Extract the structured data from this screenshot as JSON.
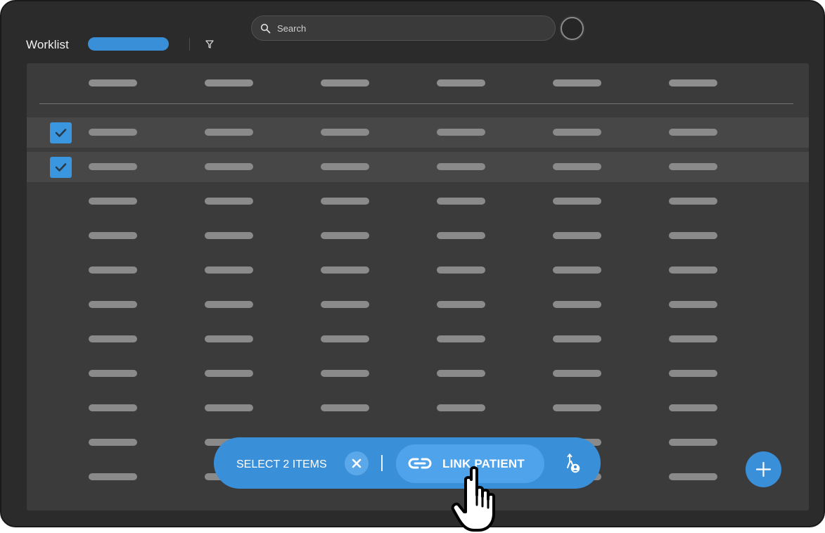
{
  "header": {
    "title": "Worklist",
    "filter_icon": "filter-icon",
    "search": {
      "placeholder": "Search",
      "icon": "search-icon"
    },
    "avatar_icon": "avatar"
  },
  "table": {
    "columns": 6,
    "total_rows": 11,
    "selected_rows": [
      1,
      2
    ],
    "checkbox_icon": "check-icon"
  },
  "action_bar": {
    "selection_label": "SELECT 2 ITEMS",
    "clear_icon": "close-icon",
    "link_label": "LINK PATIENT",
    "link_icon": "link-icon",
    "assign_icon": "assign-patient-icon"
  },
  "fab": {
    "icon": "plus-icon"
  },
  "colors": {
    "background": "#2b2b2b",
    "table": "#3b3b3b",
    "selected_row": "#474747",
    "accent": "#3a8fd9",
    "accent_light": "#4ea3ea",
    "text": "#f2f2f2"
  }
}
